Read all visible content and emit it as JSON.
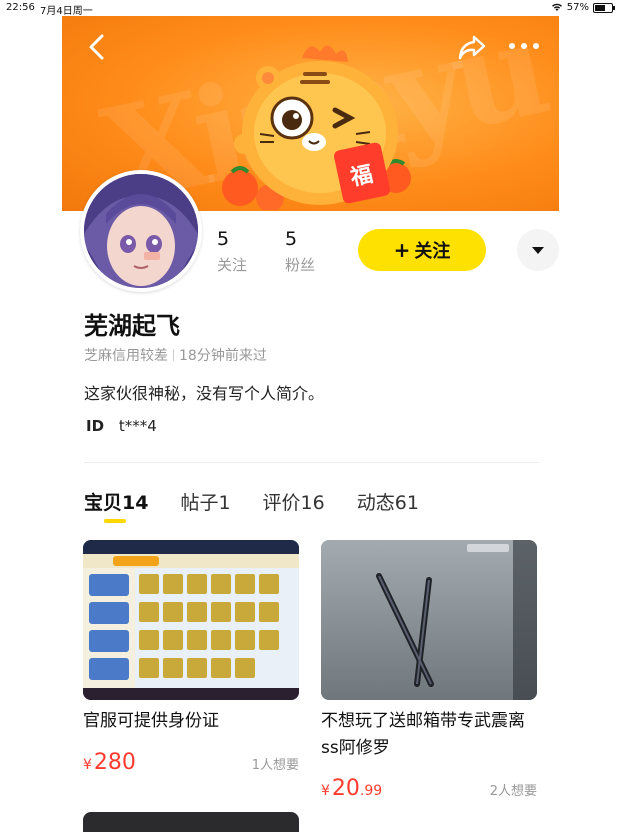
{
  "status_bar": {
    "time": "22:56",
    "date": "7月4日周一",
    "battery": "57%"
  },
  "banner": {
    "watermark": "Xianyu"
  },
  "profile": {
    "following_count": "5",
    "following_label": "关注",
    "fans_count": "5",
    "fans_label": "粉丝",
    "follow_button_label": "关注",
    "nickname": "芜湖起飞",
    "credit": "芝麻信用较差",
    "last_active": "18分钟前来过",
    "bio": "这家伙很神秘，没有写个人简介。",
    "id_label": "ID",
    "id_value": "t***4"
  },
  "tabs": [
    {
      "label": "宝贝14",
      "active": true
    },
    {
      "label": "帖子1",
      "active": false
    },
    {
      "label": "评价16",
      "active": false
    },
    {
      "label": "动态61",
      "active": false
    }
  ],
  "products": [
    {
      "title": "官服可提供身份证",
      "currency": "¥",
      "price_int": "280",
      "price_dec": "",
      "wants": "1人想要"
    },
    {
      "title": "不想玩了送邮箱带专武震离ss阿修罗",
      "currency": "¥",
      "price_int": "20",
      "price_dec": ".99",
      "wants": "2人想要"
    }
  ],
  "colors": {
    "accent_yellow": "#ffe100",
    "banner_orange": "#ff8c1a",
    "price_red": "#ff3b30"
  },
  "icons": [
    "back-icon",
    "share-icon",
    "more-icon",
    "chevron-down-icon",
    "wifi-icon",
    "battery-icon"
  ]
}
